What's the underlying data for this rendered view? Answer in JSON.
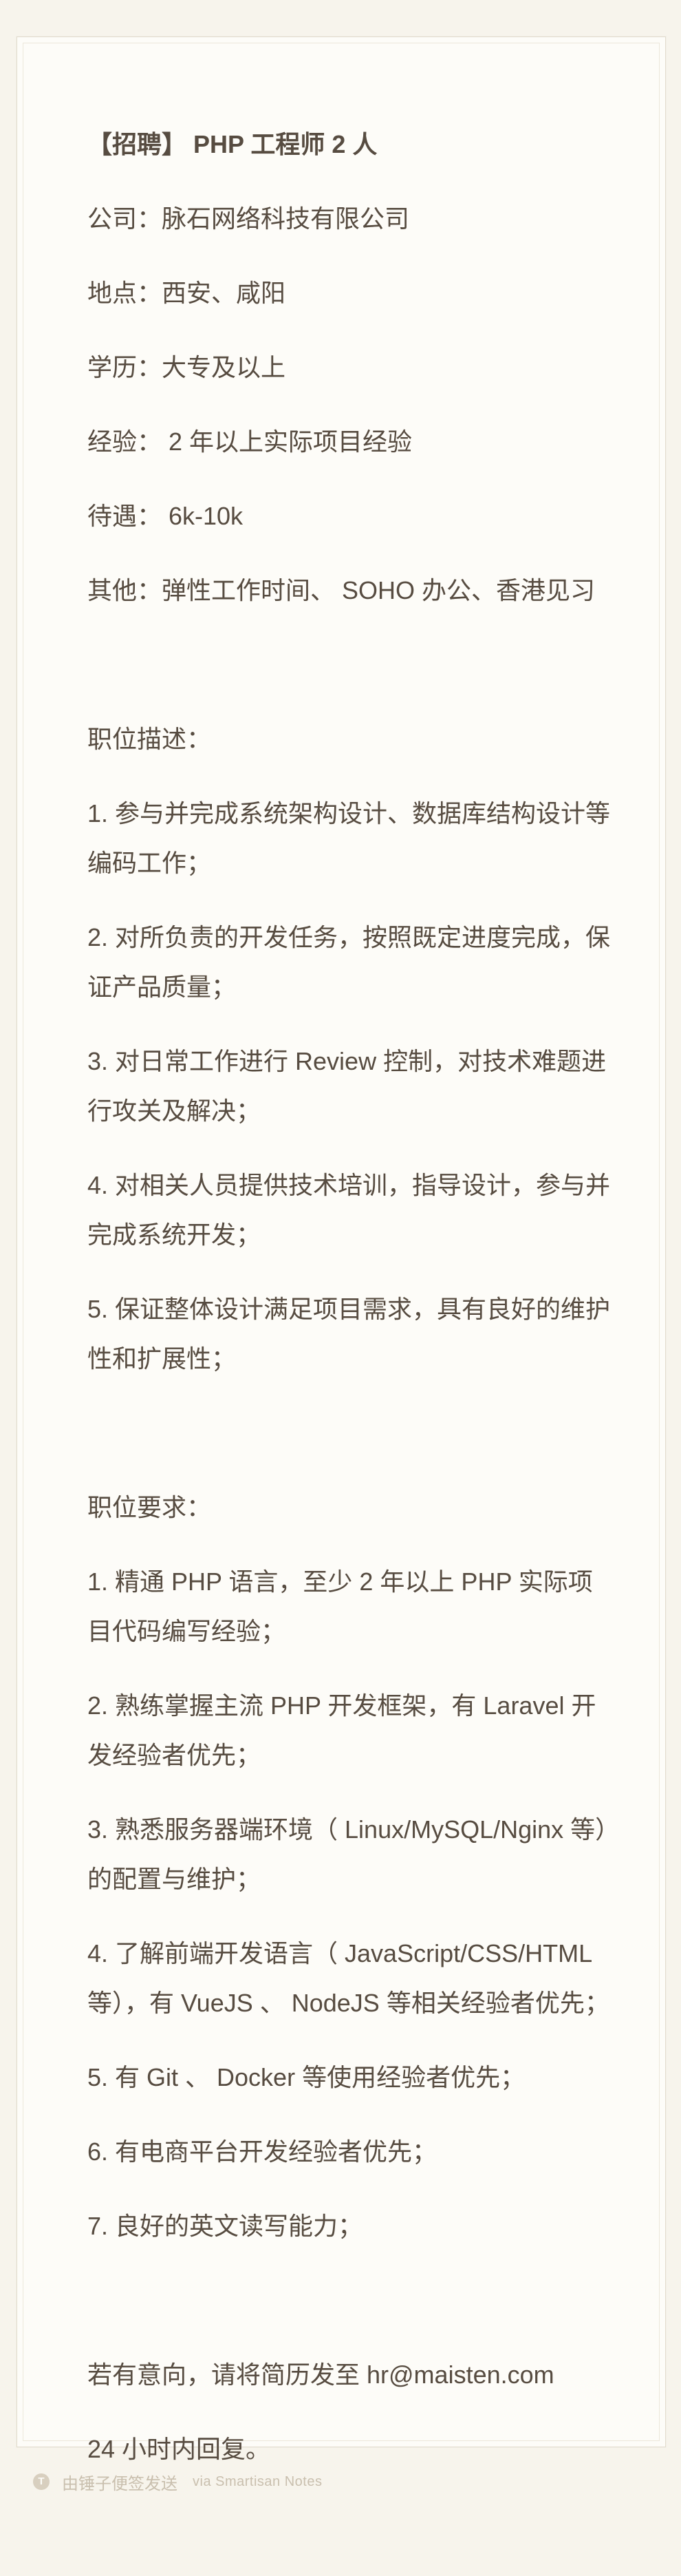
{
  "title": "【招聘】 PHP 工程师  2 人",
  "info": [
    "公司：脉石网络科技有限公司",
    "地点：西安、咸阳",
    "学历：大专及以上",
    "经验：  2 年以上实际项目经验",
    "待遇：  6k-10k",
    "其他：弹性工作时间、 SOHO 办公、香港见习"
  ],
  "description": {
    "heading": "职位描述：",
    "items": [
      "1. 参与并完成系统架构设计、数据库结构设计等编码工作；",
      "2. 对所负责的开发任务，按照既定进度完成，保证产品质量；",
      "3. 对日常工作进行 Review 控制，对技术难题进行攻关及解决；",
      "4. 对相关人员提供技术培训，指导设计，参与并完成系统开发；",
      "5. 保证整体设计满足项目需求，具有良好的维护性和扩展性；"
    ]
  },
  "requirements": {
    "heading": "职位要求：",
    "items": [
      "1. 精通 PHP 语言，至少 2 年以上 PHP 实际项目代码编写经验；",
      "2. 熟练掌握主流 PHP 开发框架，有 Laravel 开发经验者优先；",
      "3. 熟悉服务器端环境（ Linux/MySQL/Nginx 等）的配置与维护；",
      "4. 了解前端开发语言（ JavaScript/CSS/HTML 等），有 VueJS 、 NodeJS 等相关经验者优先；",
      "5. 有 Git 、 Docker 等使用经验者优先；",
      "6. 有电商平台开发经验者优先；",
      "7. 良好的英文读写能力；"
    ]
  },
  "contact": [
    "若有意向，请将简历发至 hr@maisten.com",
    "24 小时内回复。"
  ],
  "footer": {
    "icon": "smartisan-t-icon",
    "icon_glyph": "T",
    "text": "由锤子便签发送",
    "via": "via Smartisan Notes"
  }
}
